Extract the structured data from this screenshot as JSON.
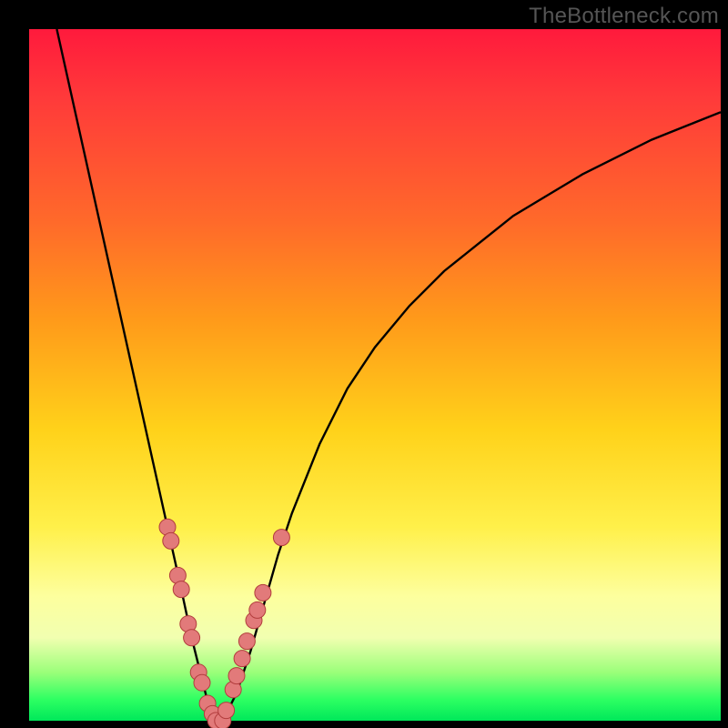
{
  "watermark": "TheBottleneck.com",
  "colors": {
    "background": "#000000",
    "curve_stroke": "#000000",
    "marker_fill": "#e27a7a",
    "marker_stroke": "#b23d3d"
  },
  "chart_data": {
    "type": "line",
    "title": "",
    "xlabel": "",
    "ylabel": "",
    "xlim": [
      0,
      100
    ],
    "ylim": [
      0,
      100
    ],
    "grid": false,
    "legend": false,
    "annotations": [
      "TheBottleneck.com"
    ],
    "series": [
      {
        "name": "bottleneck-curve",
        "type": "line",
        "x": [
          4,
          6,
          8,
          10,
          12,
          14,
          16,
          18,
          20,
          22,
          23.5,
          25,
          26,
          27,
          28,
          30,
          32,
          34,
          36,
          38,
          42,
          46,
          50,
          55,
          60,
          65,
          70,
          75,
          80,
          85,
          90,
          95,
          100
        ],
        "y": [
          100,
          91,
          82,
          73,
          64,
          55,
          46,
          37,
          28,
          19,
          12,
          6,
          2,
          0,
          0,
          4,
          10,
          17,
          24,
          30,
          40,
          48,
          54,
          60,
          65,
          69,
          73,
          76,
          79,
          81.5,
          84,
          86,
          88
        ]
      },
      {
        "name": "highlight-markers",
        "type": "scatter",
        "x": [
          20.0,
          20.5,
          21.5,
          22.0,
          23.0,
          23.5,
          24.5,
          25.0,
          25.8,
          26.5,
          27.0,
          28.0,
          28.5,
          29.5,
          30.0,
          30.8,
          31.5,
          32.5,
          33.0,
          33.8,
          36.5
        ],
        "y": [
          28.0,
          26.0,
          21.0,
          19.0,
          14.0,
          12.0,
          7.0,
          5.5,
          2.5,
          1.0,
          0.0,
          0.0,
          1.5,
          4.5,
          6.5,
          9.0,
          11.5,
          14.5,
          16.0,
          18.5,
          26.5
        ]
      }
    ]
  }
}
